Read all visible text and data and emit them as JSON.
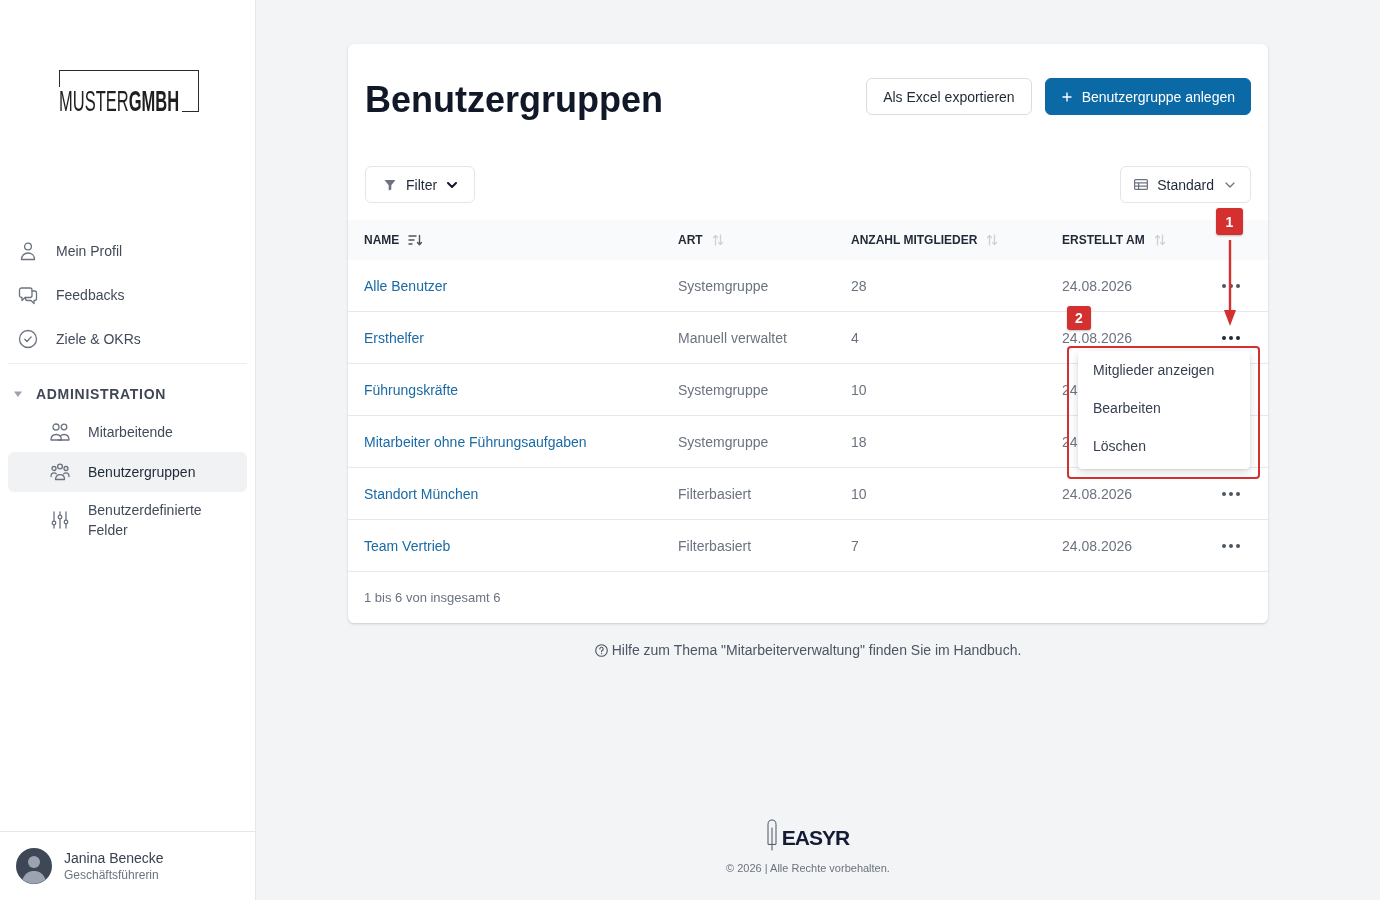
{
  "sidebar": {
    "logo": "MUSTER**GMBH**",
    "nav": [
      {
        "label": "Mein Profil",
        "selected": false
      },
      {
        "label": "Feedbacks",
        "selected": false
      },
      {
        "label": "Ziele & OKRs",
        "selected": false
      }
    ],
    "section": {
      "label": "ADMINISTRATION",
      "expanded": true,
      "items": [
        {
          "label": "Mitarbeitende",
          "selected": false
        },
        {
          "label": "Benutzergruppen",
          "selected": true
        },
        {
          "label": "Benutzerdefinierte Felder",
          "selected": false
        }
      ]
    },
    "user": {
      "name": "Janina Benecke",
      "role": "Geschäftsführerin"
    }
  },
  "page": {
    "title": "Benutzergruppen",
    "buttons": [
      {
        "label": "Als Excel exportieren",
        "kind": "secondary"
      },
      {
        "label": "Benutzergruppe anlegen",
        "kind": "primary"
      }
    ],
    "filter": {
      "label": "Filter"
    },
    "view": {
      "label": "Standard"
    }
  },
  "table": {
    "columns": [
      {
        "label": "NAME",
        "sorted": true
      },
      {
        "label": "ART",
        "sorted": false
      },
      {
        "label": "ANZAHL MITGLIEDER",
        "sorted": false
      },
      {
        "label": "ERSTELLT AM",
        "sorted": false
      }
    ],
    "rows": [
      {
        "name": "Alle Benutzer",
        "type": "Systemgruppe",
        "members": "28",
        "created": "24.08.2026",
        "menu_open": false
      },
      {
        "name": "Ersthelfer",
        "type": "Manuell verwaltet",
        "members": "4",
        "created": "24.08.2026",
        "menu_open": true
      },
      {
        "name": "Führungskräfte",
        "type": "Systemgruppe",
        "members": "10",
        "created": "24",
        "menu_open": false
      },
      {
        "name": "Mitarbeiter ohne Führungsaufgaben",
        "type": "Systemgruppe",
        "members": "18",
        "created": "24",
        "menu_open": false
      },
      {
        "name": "Standort München",
        "type": "Filterbasiert",
        "members": "10",
        "created": "24.08.2026",
        "menu_open": false
      },
      {
        "name": "Team Vertrieb",
        "type": "Filterbasiert",
        "members": "7",
        "created": "24.08.2026",
        "menu_open": false
      }
    ],
    "row_menu": {
      "items": [
        "Mitglieder anzeigen",
        "Bearbeiten",
        "Löschen"
      ]
    },
    "pagination": "1 bis 6 von insgesamt 6"
  },
  "annotations": [
    {
      "label": "1",
      "kind": "arrow"
    },
    {
      "label": "2",
      "kind": "frame"
    }
  ],
  "help": "Hilfe zum Thema \"Mitarbeiterverwaltung\" finden Sie im Handbuch.",
  "footer": {
    "brand": "EASYR",
    "copyright": "© 2026 | Alle Rechte vorbehalten."
  }
}
